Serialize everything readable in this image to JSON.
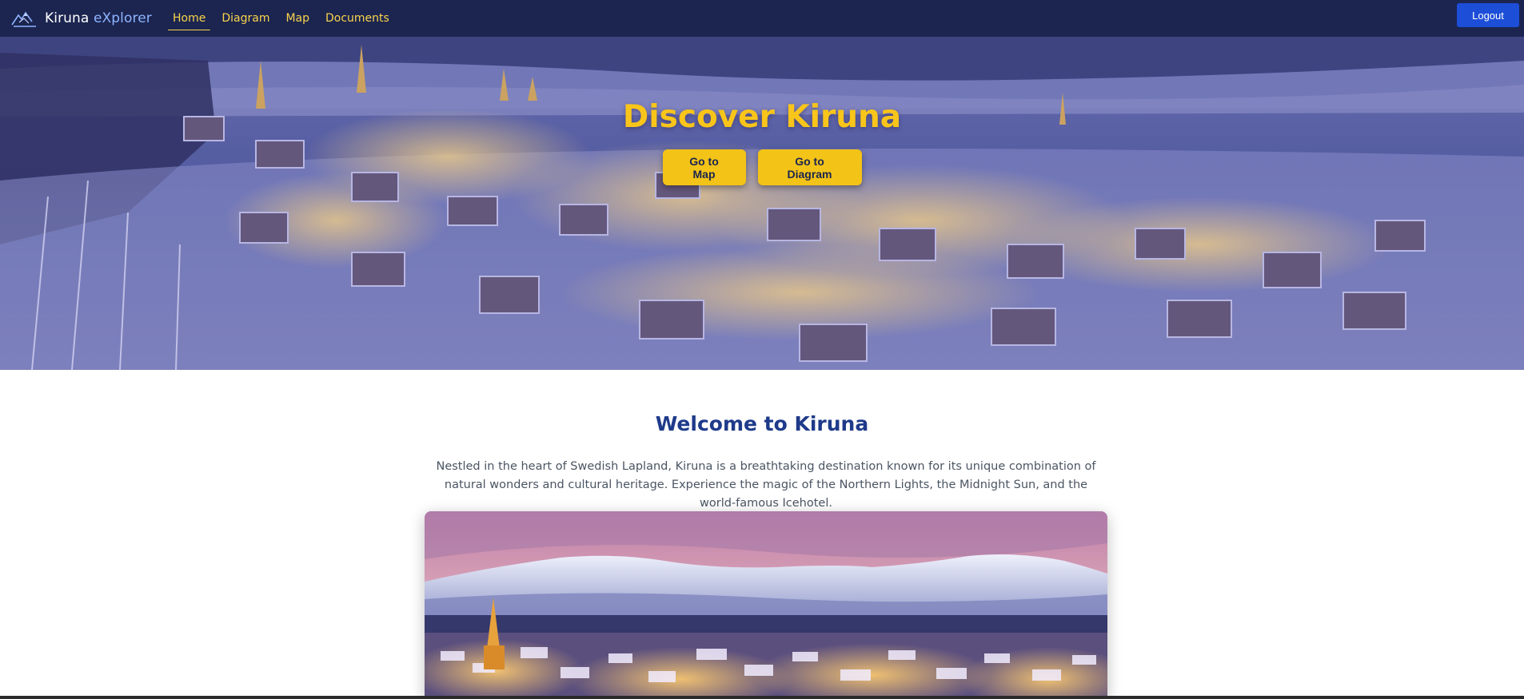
{
  "navbar": {
    "brand": {
      "name": "Kiruna",
      "accent": "eXplorer",
      "logo_icon": "mountain-logo-icon"
    },
    "links": [
      {
        "label": "Home",
        "active": true
      },
      {
        "label": "Diagram",
        "active": false
      },
      {
        "label": "Map",
        "active": false
      },
      {
        "label": "Documents",
        "active": false
      }
    ],
    "logout_label": "Logout"
  },
  "hero": {
    "title": "Discover Kiruna",
    "buttons": {
      "map": "Go to Map",
      "diagram": "Go to Diagram"
    }
  },
  "welcome": {
    "title": "Welcome to Kiruna",
    "description": "Nestled in the heart of Swedish Lapland, Kiruna is a breathtaking destination known for its unique combination of natural wonders and cultural heritage. Experience the magic of the Northern Lights, the Midnight Sun, and the world-famous Icehotel."
  },
  "colors": {
    "nav_bg": "#1b2550",
    "nav_link": "#fbd34d",
    "logout_bg": "#1d4ed8",
    "hero_accent": "#f9c51a",
    "heading": "#1e3a8a",
    "body_text": "#4b5563"
  }
}
